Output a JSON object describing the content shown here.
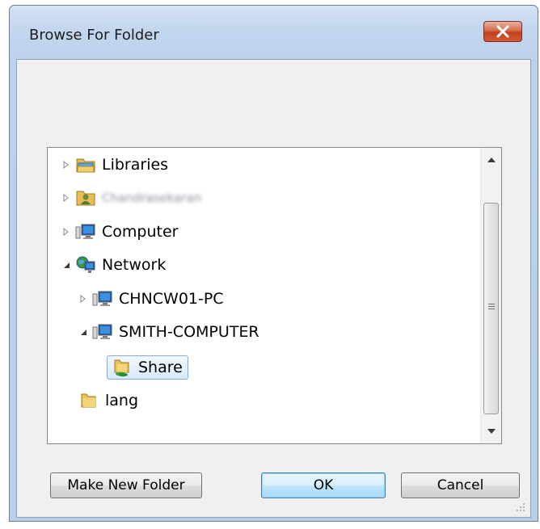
{
  "window": {
    "title": "Browse For Folder"
  },
  "tree": {
    "items": [
      {
        "label": "Libraries",
        "icon": "libraries-icon",
        "expander": "collapsed"
      },
      {
        "label": "Chandrasekaran",
        "icon": "user-folder-icon",
        "expander": "collapsed",
        "obscured": true
      },
      {
        "label": "Computer",
        "icon": "computer-icon",
        "expander": "collapsed"
      },
      {
        "label": "Network",
        "icon": "network-icon",
        "expander": "expanded"
      },
      {
        "label": "CHNCW01-PC",
        "icon": "computer-icon",
        "expander": "collapsed"
      },
      {
        "label": "SMITH-COMPUTER",
        "icon": "computer-icon",
        "expander": "expanded"
      },
      {
        "label": "Share",
        "icon": "shared-folder-icon",
        "expander": "none",
        "selected": true
      },
      {
        "label": "lang",
        "icon": "folder-icon",
        "expander": "none"
      }
    ]
  },
  "buttons": {
    "make_new_folder": "Make New Folder",
    "ok": "OK",
    "cancel": "Cancel"
  },
  "colors": {
    "title_bar": "#c3d6ee",
    "close_button": "#c2401f",
    "selection": "#d8eafc",
    "ok_button": "#bee6fd"
  }
}
